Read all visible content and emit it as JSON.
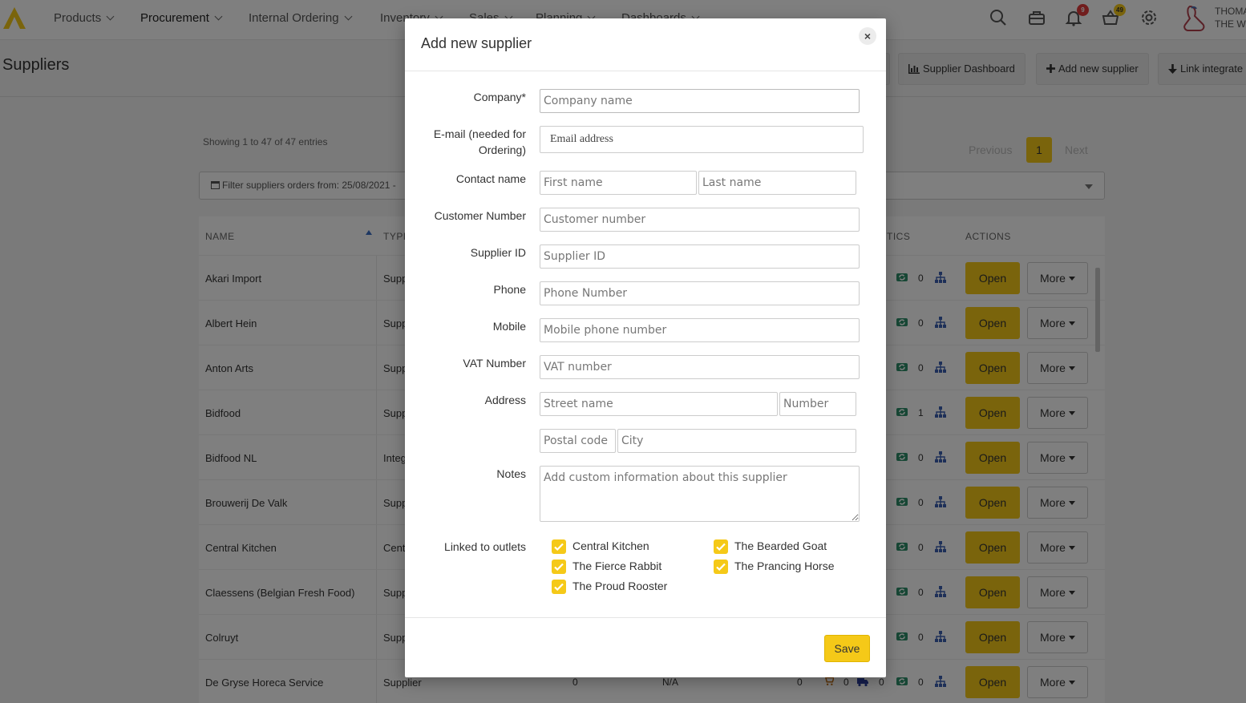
{
  "nav": {
    "items": [
      {
        "label": "Products"
      },
      {
        "label": "Procurement"
      },
      {
        "label": "Internal Ordering"
      },
      {
        "label": "Inventory"
      },
      {
        "label": "Sales"
      },
      {
        "label": "Planning"
      },
      {
        "label": "Dashboards"
      }
    ],
    "notifications_count": "9",
    "orders_count": "49",
    "user_line1": "THOMA",
    "user_line2": "THE W"
  },
  "page": {
    "title": "Suppliers",
    "buttons": {
      "dashboard": "Supplier Dashboard",
      "add": "Add new supplier",
      "link": "Link integrate"
    },
    "showing": "Showing 1 to 47 of 47 entries",
    "pagination": {
      "prev": "Previous",
      "current": "1",
      "next": "Next"
    },
    "filter": "Filter suppliers orders from: 25/08/2021 -"
  },
  "table": {
    "headers": {
      "name": "NAME",
      "type": "TYPE",
      "statistics": "TICS",
      "actions": "ACTIONS"
    },
    "rows": [
      {
        "name": "Akari Import",
        "type": "Supp",
        "stat": "0"
      },
      {
        "name": "Albert Hein",
        "type": "Supp",
        "stat": "0"
      },
      {
        "name": "Anton Arts",
        "type": "Supp",
        "stat": "0"
      },
      {
        "name": "Bidfood",
        "type": "Supp",
        "stat": "1"
      },
      {
        "name": "Bidfood NL",
        "type": "Integ",
        "stat": "0"
      },
      {
        "name": "Brouwerij De Valk",
        "type": "Supp",
        "stat": "0"
      },
      {
        "name": "Central Kitchen",
        "type": "Cent",
        "stat": "0"
      },
      {
        "name": "Claessens (Belgian Fresh Food)",
        "type": "Supp",
        "stat": "0"
      },
      {
        "name": "Colruyt",
        "type": "Supp",
        "stat": "0"
      },
      {
        "name": "De Gryse Horeca Service",
        "type": "Supplier",
        "stat": "0",
        "extra": {
          "c1": "0",
          "c2": "N/A",
          "c3": "0",
          "c4": "0",
          "c5": "0"
        }
      }
    ],
    "open_label": "Open",
    "more_label": "More"
  },
  "modal": {
    "title": "Add new supplier",
    "close": "×",
    "fields": {
      "company": {
        "label": "Company*",
        "placeholder": "Company name"
      },
      "email": {
        "label_line1": "E-mail (needed for",
        "label_line2": "Ordering)",
        "placeholder": "Email address"
      },
      "contact": {
        "label": "Contact name",
        "first_placeholder": "First name",
        "last_placeholder": "Last name"
      },
      "customer_number": {
        "label": "Customer Number",
        "placeholder": "Customer number"
      },
      "supplier_id": {
        "label": "Supplier ID",
        "placeholder": "Supplier ID"
      },
      "phone": {
        "label": "Phone",
        "placeholder": "Phone Number"
      },
      "mobile": {
        "label": "Mobile",
        "placeholder": "Mobile phone number"
      },
      "vat": {
        "label": "VAT Number",
        "placeholder": "VAT number"
      },
      "address": {
        "label": "Address",
        "street_placeholder": "Street name",
        "number_placeholder": "Number",
        "postal_placeholder": "Postal code",
        "city_placeholder": "City"
      },
      "notes": {
        "label": "Notes",
        "placeholder": "Add custom information about this supplier"
      }
    },
    "outlets": {
      "label": "Linked to outlets",
      "items": [
        {
          "label": "Central Kitchen",
          "checked": true
        },
        {
          "label": "The Bearded Goat",
          "checked": true
        },
        {
          "label": "The Fierce Rabbit",
          "checked": true
        },
        {
          "label": "The Prancing Horse",
          "checked": true
        },
        {
          "label": "The Proud Rooster",
          "checked": true
        }
      ]
    },
    "save": "Save"
  },
  "colors": {
    "accent": "#f5c918",
    "overlay": "rgba(0,0,0,0.5)"
  }
}
